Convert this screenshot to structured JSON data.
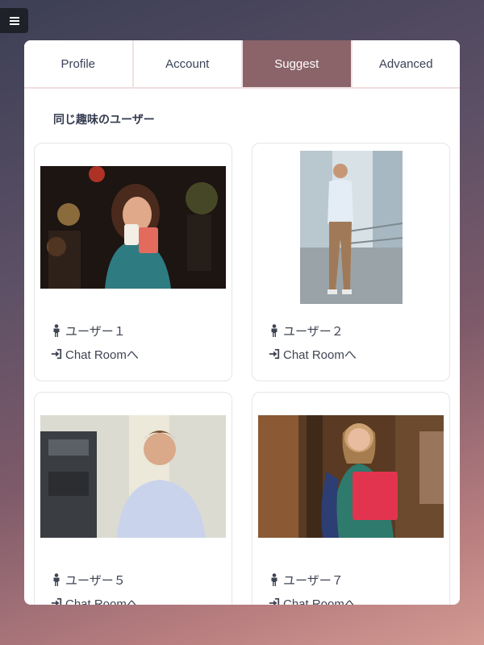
{
  "tabs": [
    {
      "label": "Profile",
      "active": false
    },
    {
      "label": "Account",
      "active": false
    },
    {
      "label": "Suggest",
      "active": true
    },
    {
      "label": "Advanced",
      "active": false
    }
  ],
  "section_title": "同じ趣味のユーザー",
  "cards": [
    {
      "user": "ユーザー１",
      "link": "Chat Roomへ"
    },
    {
      "user": "ユーザー２",
      "link": "Chat Roomへ"
    },
    {
      "user": "ユーザー５",
      "link": "Chat Roomへ"
    },
    {
      "user": "ユーザー７",
      "link": "Chat Roomへ"
    }
  ],
  "colors": {
    "accent": "#8a6469",
    "menu_bg": "#1f2129"
  }
}
